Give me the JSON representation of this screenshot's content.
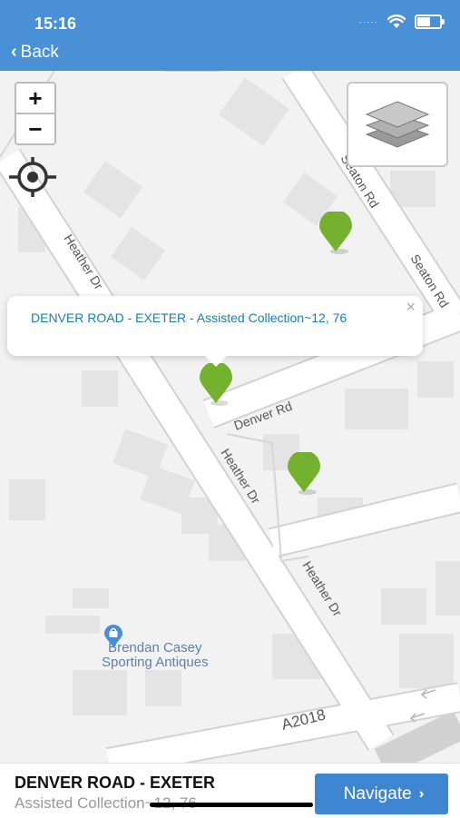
{
  "status": {
    "time": "15:16",
    "battery_level": 0.6,
    "dots": "·····"
  },
  "header": {
    "back_label": "Back",
    "back_icon": "chevron-left"
  },
  "map": {
    "roads": [
      "Seaton Rd",
      "Heather Dr",
      "Denver Rd",
      "A2018"
    ],
    "poi": {
      "line1": "Brendan Casey",
      "line2": "Sporting Antiques",
      "icon": "shopping-bag-icon"
    },
    "controls": {
      "zoom_in": "+",
      "zoom_out": "−"
    },
    "marker_color": "#74b12e"
  },
  "popup": {
    "text": "DENVER ROAD - EXETER - Assisted Collection~12, 76",
    "close": "×"
  },
  "bottom": {
    "title": "DENVER ROAD - EXETER",
    "subtitle": "Assisted Collection~12, 76",
    "navigate_label": "Navigate"
  }
}
